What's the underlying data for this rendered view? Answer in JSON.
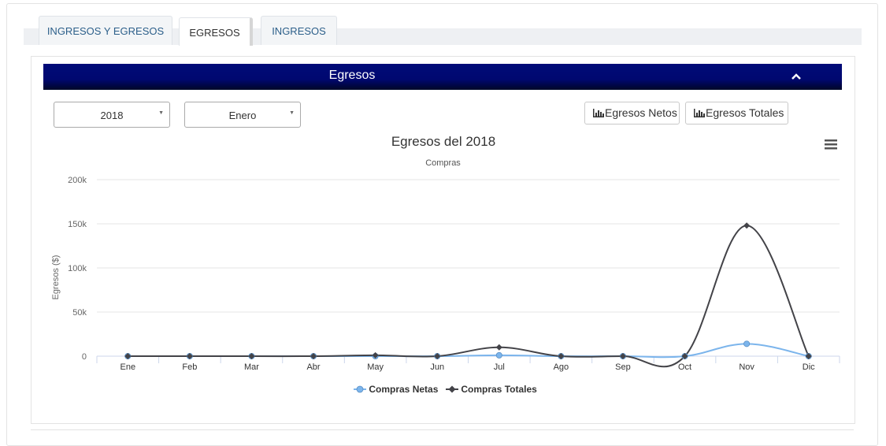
{
  "tabs": [
    {
      "label": "INGRESOS Y EGRESOS",
      "active": false
    },
    {
      "label": "EGRESOS",
      "active": true
    },
    {
      "label": "INGRESOS",
      "active": false
    }
  ],
  "panel": {
    "title": "Egresos",
    "collapse_icon": "chevron-up-icon"
  },
  "filters": {
    "year": "2018",
    "month": "Enero"
  },
  "buttons": {
    "netos": "Egresos Netos",
    "totales": "Egresos Totales",
    "icon": "bar-chart-icon"
  },
  "menu_icon": "hamburger-menu-icon",
  "colors": {
    "header": "#000870",
    "series_netas": "#7cb5ec",
    "series_totales": "#434348"
  },
  "chart_data": {
    "type": "line",
    "title": "Egresos del 2018",
    "subtitle": "Compras",
    "xlabel": "",
    "ylabel": "Egresos ($)",
    "categories": [
      "Ene",
      "Feb",
      "Mar",
      "Abr",
      "May",
      "Jun",
      "Jul",
      "Ago",
      "Sep",
      "Oct",
      "Nov",
      "Dic"
    ],
    "ylim": [
      0,
      200000
    ],
    "yticks": [
      {
        "value": 0,
        "label": "0"
      },
      {
        "value": 50000,
        "label": "50k"
      },
      {
        "value": 100000,
        "label": "100k"
      },
      {
        "value": 150000,
        "label": "150k"
      },
      {
        "value": 200000,
        "label": "200k"
      }
    ],
    "grid": true,
    "legend": "bottom-center",
    "series": [
      {
        "name": "Compras Netas",
        "marker": "circle",
        "values": [
          0,
          0,
          0,
          0,
          0,
          0,
          1000,
          0,
          0,
          0,
          14000,
          0
        ]
      },
      {
        "name": "Compras Totales",
        "marker": "diamond",
        "values": [
          0,
          0,
          0,
          0,
          1000,
          0,
          10000,
          0,
          0,
          0,
          148000,
          0
        ]
      }
    ]
  }
}
